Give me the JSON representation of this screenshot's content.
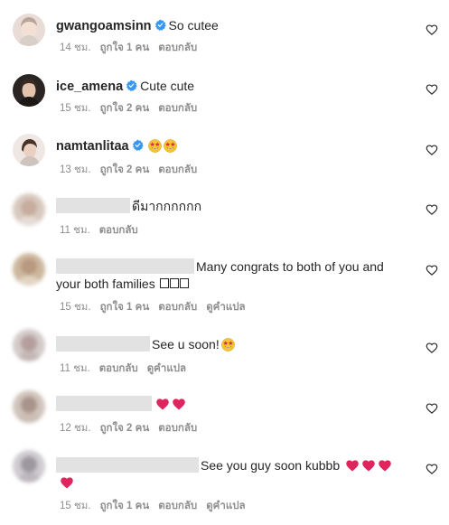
{
  "comments": [
    {
      "user": "gwangoamsinn",
      "verified": true,
      "text": "So cutee",
      "time": "14 ชม.",
      "likes": "ถูกใจ 1 คน",
      "reply": "ตอบกลับ",
      "translate": ""
    },
    {
      "user": "ice_amena",
      "verified": true,
      "text": "Cute cute",
      "time": "15 ชม.",
      "likes": "ถูกใจ 2 คน",
      "reply": "ตอบกลับ",
      "translate": ""
    },
    {
      "user": "namtanlitaa",
      "verified": true,
      "text": "",
      "time": "13 ชม.",
      "likes": "ถูกใจ 2 คน",
      "reply": "ตอบกลับ",
      "translate": ""
    },
    {
      "user": "",
      "verified": false,
      "text": "ดีมากกกกกก",
      "time": "11 ชม.",
      "likes": "",
      "reply": "ตอบกลับ",
      "translate": ""
    },
    {
      "user": "",
      "verified": false,
      "text": "Many congrats to both of you and",
      "text2": "your both families",
      "time": "15 ชม.",
      "likes": "ถูกใจ 1 คน",
      "reply": "ตอบกลับ",
      "translate": "ดูคำแปล"
    },
    {
      "user": "",
      "verified": false,
      "text": "See u soon!",
      "time": "11 ชม.",
      "likes": "",
      "reply": "ตอบกลับ",
      "translate": "ดูคำแปล"
    },
    {
      "user": "",
      "verified": false,
      "text": "",
      "time": "12 ชม.",
      "likes": "ถูกใจ 2 คน",
      "reply": "ตอบกลับ",
      "translate": ""
    },
    {
      "user": "",
      "verified": false,
      "text": "See you guy soon kubbb",
      "time": "15 ชม.",
      "likes": "ถูกใจ 1 คน",
      "reply": "ตอบกลับ",
      "translate": "ดูคำแปล"
    }
  ],
  "colors": {
    "verified": "#3897f0",
    "meta": "#8e8e8e",
    "heart_red": "#e0245e",
    "redaction": "#e2e2e2"
  },
  "icons": {
    "like": "heart-outline-icon",
    "verified": "verified-badge-icon",
    "emoji": "star-struck-emoji-icon"
  }
}
